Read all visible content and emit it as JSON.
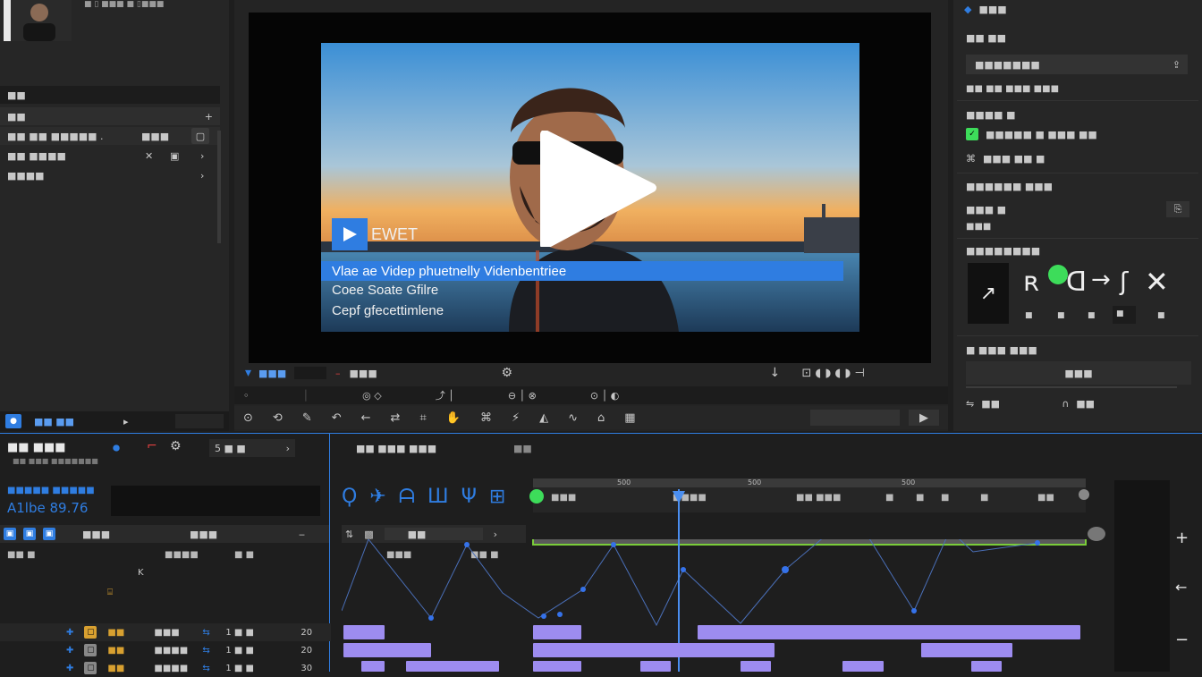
{
  "left_panel": {
    "top_label": "■ ▯ ■■■ ■ ▯■■■",
    "section_header": "■■",
    "dropdown_label": "■■",
    "rows": [
      {
        "label": "■■ ■■ ■■■■■ .",
        "value": "■■■",
        "icon": "square-icon"
      },
      {
        "label": "■■ ■■■■",
        "value": "✕",
        "icon": "frame-icon"
      },
      {
        "label": "■■■■",
        "value": ""
      }
    ],
    "bottom_bar": {
      "label": "■■ ■■",
      "arrow": "▸"
    }
  },
  "preview": {
    "logo_text": "EWET",
    "banner_line1": "Vlae ae Videp phuetnelly Videnbentriee",
    "line2": "Coee Soate Gfilre",
    "line3": "Cepf gfecettimlene",
    "label_left": "■■■",
    "label_mid": "■■■",
    "toolbar_right": "⊡ ◖ ◗ ◖ ◗ ⊣"
  },
  "right_panel": {
    "title": "■■■",
    "section1": "■■ ■■",
    "dropdown_value": "■■■■■■■",
    "line1": "■■ ■■ ■■■ ■■■",
    "section2": "■■■■ ■",
    "item_green": "■■■■■ ■ ■■■ ■■",
    "item2": "■■■ ■■ ■",
    "section3": "■■■■■■ ■■■",
    "item3": "■■■ ■",
    "item3b": "■■■",
    "section4": "■■■■■■■■",
    "glyph_labels": [
      "■",
      "■",
      "■",
      "■",
      "■"
    ],
    "section5": "■ ■■■ ■■■",
    "center_value": "■■■",
    "foot_left": "■■",
    "foot_right": "■■"
  },
  "timeline": {
    "title": "■■ ■■■",
    "subtitle": "■■ ■■■ ■■■■■■■",
    "counter": "5 ■ ■",
    "header_mid": "■■ ■■■ ■■■",
    "header_right": "■■",
    "timecode_label": "■■■■■ ■■■■■",
    "timecode": "A1lbe 89.76",
    "ruler_marks": [
      "500",
      "500",
      "500"
    ],
    "ruler_labels": [
      "■■■",
      "■■■■",
      "■■ ■■■",
      "■",
      "■",
      "■",
      "■",
      "■■"
    ],
    "col_header_a": "■■■",
    "col_header_b": "■■■",
    "col_mid": "■■",
    "param_a": "■■■",
    "param_b": "■■ ■",
    "params_left": [
      "■■ ■",
      "■■■■",
      "■ ■"
    ],
    "tracks": [
      {
        "tag": "■■",
        "a": "■■■",
        "b": "1 ■ ■",
        "c": "20"
      },
      {
        "tag": "■■",
        "a": "■■■■",
        "b": "1 ■ ■",
        "c": "20"
      },
      {
        "tag": "■■",
        "a": "■■■■",
        "b": "1 ■ ■",
        "c": "30"
      }
    ]
  },
  "colors": {
    "accent": "#2f7de1",
    "clip": "#9d8cf0",
    "green": "#3ddc5a",
    "keyframe": "#2f6fe0"
  }
}
